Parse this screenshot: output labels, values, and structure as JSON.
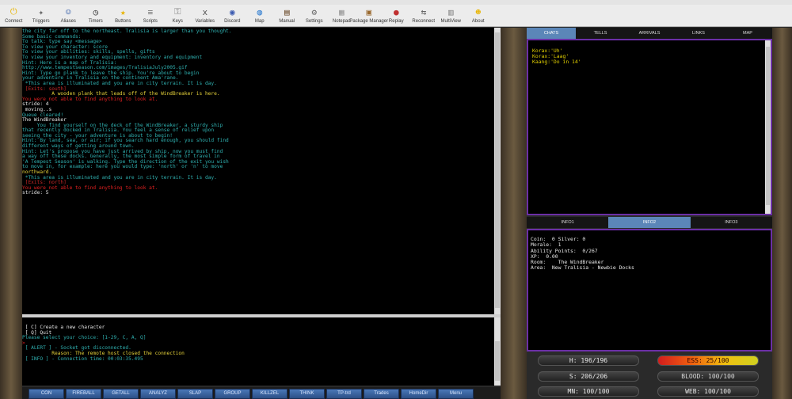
{
  "toolbar": [
    {
      "label": "Connect",
      "icon": "power-icon",
      "color": "#e8b400"
    },
    {
      "label": "Triggers",
      "icon": "gun-icon",
      "color": "#666666"
    },
    {
      "label": "Aliases",
      "icon": "people-icon",
      "color": "#4a6fb0"
    },
    {
      "label": "Timers",
      "icon": "clock-icon",
      "color": "#333333"
    },
    {
      "label": "Buttons",
      "icon": "star-icon",
      "color": "#e8b400"
    },
    {
      "label": "Scripts",
      "icon": "scroll-icon",
      "color": "#777777"
    },
    {
      "label": "Keys",
      "icon": "key-icon",
      "color": "#888888"
    },
    {
      "label": "Variables",
      "icon": "variable-icon",
      "color": "#555555"
    },
    {
      "label": "Discord",
      "icon": "discord-icon",
      "color": "#3a5ab0"
    },
    {
      "label": "Map",
      "icon": "globe-icon",
      "color": "#2a7ad0"
    },
    {
      "label": "Manual",
      "icon": "book-icon",
      "color": "#6a4a2a"
    },
    {
      "label": "Settings",
      "icon": "gear-icon",
      "color": "#666666"
    },
    {
      "label": "Notepad",
      "icon": "notepad-icon",
      "color": "#999999"
    },
    {
      "label": "Package Manager",
      "icon": "package-icon",
      "color": "#9a6a30"
    },
    {
      "label": "Replay",
      "icon": "replay-icon",
      "color": "#c03030"
    },
    {
      "label": "Reconnect",
      "icon": "reconnect-icon",
      "color": "#555555"
    },
    {
      "label": "MultiView",
      "icon": "multiview-icon",
      "color": "#888888"
    },
    {
      "label": "About",
      "icon": "about-icon",
      "color": "#e8b400"
    }
  ],
  "output": [
    {
      "t": "the city far off to the northeast. Tralisia is larger than you thought.",
      "c": "#2fb0b0"
    },
    {
      "t": "",
      "c": "#2fb0b0"
    },
    {
      "t": "Some basic commands:",
      "c": "#2fb0b0"
    },
    {
      "t": "To talk: type say <message>",
      "c": "#2fb0b0"
    },
    {
      "t": "To view your character: score",
      "c": "#2fb0b0"
    },
    {
      "t": "To view your abilities: skills, spells, gifts",
      "c": "#2fb0b0"
    },
    {
      "t": "To view your inventory and equipment: inventory and equipment",
      "c": "#2fb0b0"
    },
    {
      "t": "",
      "c": "#2fb0b0"
    },
    {
      "t": "Hint: Here is a map of Tralisia:",
      "c": "#2fb0b0"
    },
    {
      "t": "http://www.tempestseason.com/images/TralisiaJuly2005.gif",
      "c": "#2fb0b0"
    },
    {
      "t": "",
      "c": "#2fb0b0"
    },
    {
      "t": "Hint: Type go plank to leave the ship. You're about to begin",
      "c": "#2fb0b0"
    },
    {
      "t": "your adventure in Tralisia on the continent Ama'rane.",
      "c": "#2fb0b0"
    },
    {
      "t": "",
      "c": "#2fb0b0"
    },
    {
      "t": " *This area is illuminated and you are in city terrain. It is day.",
      "c": "#2fb0b0"
    },
    {
      "t": "",
      "c": "#2fb0b0"
    },
    {
      "t": " [Exits: south]",
      "c": "#c82828"
    },
    {
      "t": "          A wooden plank that leads off of the WindBreaker is here.",
      "c": "#e6d23a"
    },
    {
      "t": "",
      "c": "#2fb0b0"
    },
    {
      "t": "You were not able to find anything to look at.",
      "c": "#e02020"
    },
    {
      "t": "stride: 4",
      "c": "#e6e6e6"
    },
    {
      "t": "",
      "c": "#2fb0b0"
    },
    {
      "t": " moving..s",
      "c": "#e6e6e6"
    },
    {
      "t": "",
      "c": "#2fb0b0"
    },
    {
      "t": "Queue cleared!",
      "c": "#2fb0b0"
    },
    {
      "t": "",
      "c": "#2fb0b0"
    },
    {
      "t": "The WindBreaker",
      "c": "#e6e6e6"
    },
    {
      "t": "     You find yourself on the deck of the WindBreaker, a sturdy ship",
      "c": "#2fb0b0"
    },
    {
      "t": "that recently docked in Tralisia. You feel a sense of relief upon",
      "c": "#2fb0b0"
    },
    {
      "t": "seeing the city - your adventure is about to begin!",
      "c": "#2fb0b0"
    },
    {
      "t": "",
      "c": "#2fb0b0"
    },
    {
      "t": "",
      "c": "#2fb0b0"
    },
    {
      "t": "Hint: By land, sea, or air; if you search hard enough, you should find",
      "c": "#2fb0b0"
    },
    {
      "t": "different ways of getting around town.",
      "c": "#2fb0b0"
    },
    {
      "t": "",
      "c": "#2fb0b0"
    },
    {
      "t": "",
      "c": "#2fb0b0"
    },
    {
      "t": "Hint: Let's propose you have just arrived by ship, now you must find",
      "c": "#2fb0b0"
    },
    {
      "t": "a way off these docks. Generally, the most simple form of travel in",
      "c": "#2fb0b0"
    },
    {
      "t": "'A Tempest Season' is walking. Type the direction of the exit you wish",
      "c": "#2fb0b0"
    },
    {
      "t": "to move in, for example: here you would type: 'north' or 'n' to move",
      "c": "#2fb0b0"
    },
    {
      "t": "northward.",
      "c": "#e6d23a"
    },
    {
      "t": "",
      "c": "#2fb0b0"
    },
    {
      "t": " *This area is illuminated and you are in city terrain. It is day.",
      "c": "#2fb0b0"
    },
    {
      "t": "",
      "c": "#2fb0b0"
    },
    {
      "t": " [Exits: north]",
      "c": "#c82828"
    },
    {
      "t": "",
      "c": "#2fb0b0"
    },
    {
      "t": "You were not able to find anything to look at.",
      "c": "#e02020"
    },
    {
      "t": "stride: 5",
      "c": "#e6e6e6"
    }
  ],
  "output2": [
    {
      "t": " [ C] Create a new character",
      "c": "#e6e6e6"
    },
    {
      "t": " [ Q] Quit",
      "c": "#e6e6e6"
    },
    {
      "t": "",
      "c": "#e6e6e6"
    },
    {
      "t": "Please select your choice: [1-29, C, A, Q]",
      "c": "#2fb0b0"
    },
    {
      "t": ">",
      "c": "#e02020"
    },
    {
      "t": "",
      "c": "#e6e6e6"
    },
    {
      "t": " [ ALERT ] - Socket got disconnected.",
      "c": "#2fb0b0"
    },
    {
      "t": "          Reason: The remote host closed the connection",
      "c": "#e6d23a"
    },
    {
      "t": " [ INFO ] - Connection time: 00:03:35.495",
      "c": "#2fb0b0"
    }
  ],
  "cmdbuttons": [
    "CON",
    "FIREBALL",
    "GETALL",
    "ANALYZ",
    "SLAP",
    "GROUP",
    "KILLZEL",
    "THINK",
    "TP-trd",
    "Trades",
    "HomeDir",
    "Menu"
  ],
  "tabs_top": [
    "CHATS",
    "TELLS",
    "ARRIVALS",
    "LINKS",
    "MAP"
  ],
  "chat": [
    "Korax:'Uh'",
    "Korax:'Laag'",
    "Kaang:'Do in 14'"
  ],
  "tabs_info": [
    "INFO1",
    "INFO2",
    "INFO3"
  ],
  "info": [
    "Coin:  0 Silver: 0",
    "Morale:  1",
    "Ability Points:  0/267",
    "XP:  0.00",
    "Room:    The WindBreaker",
    "Area:  New Tralisia - Newbie Docks"
  ],
  "stats": {
    "hp": "H: 196/196",
    "ess": "ESS: 25/100",
    "s": "S: 206/206",
    "blood": "BLOOD: 100/100",
    "mn": "MN: 100/100",
    "web": "WEB: 100/100"
  }
}
